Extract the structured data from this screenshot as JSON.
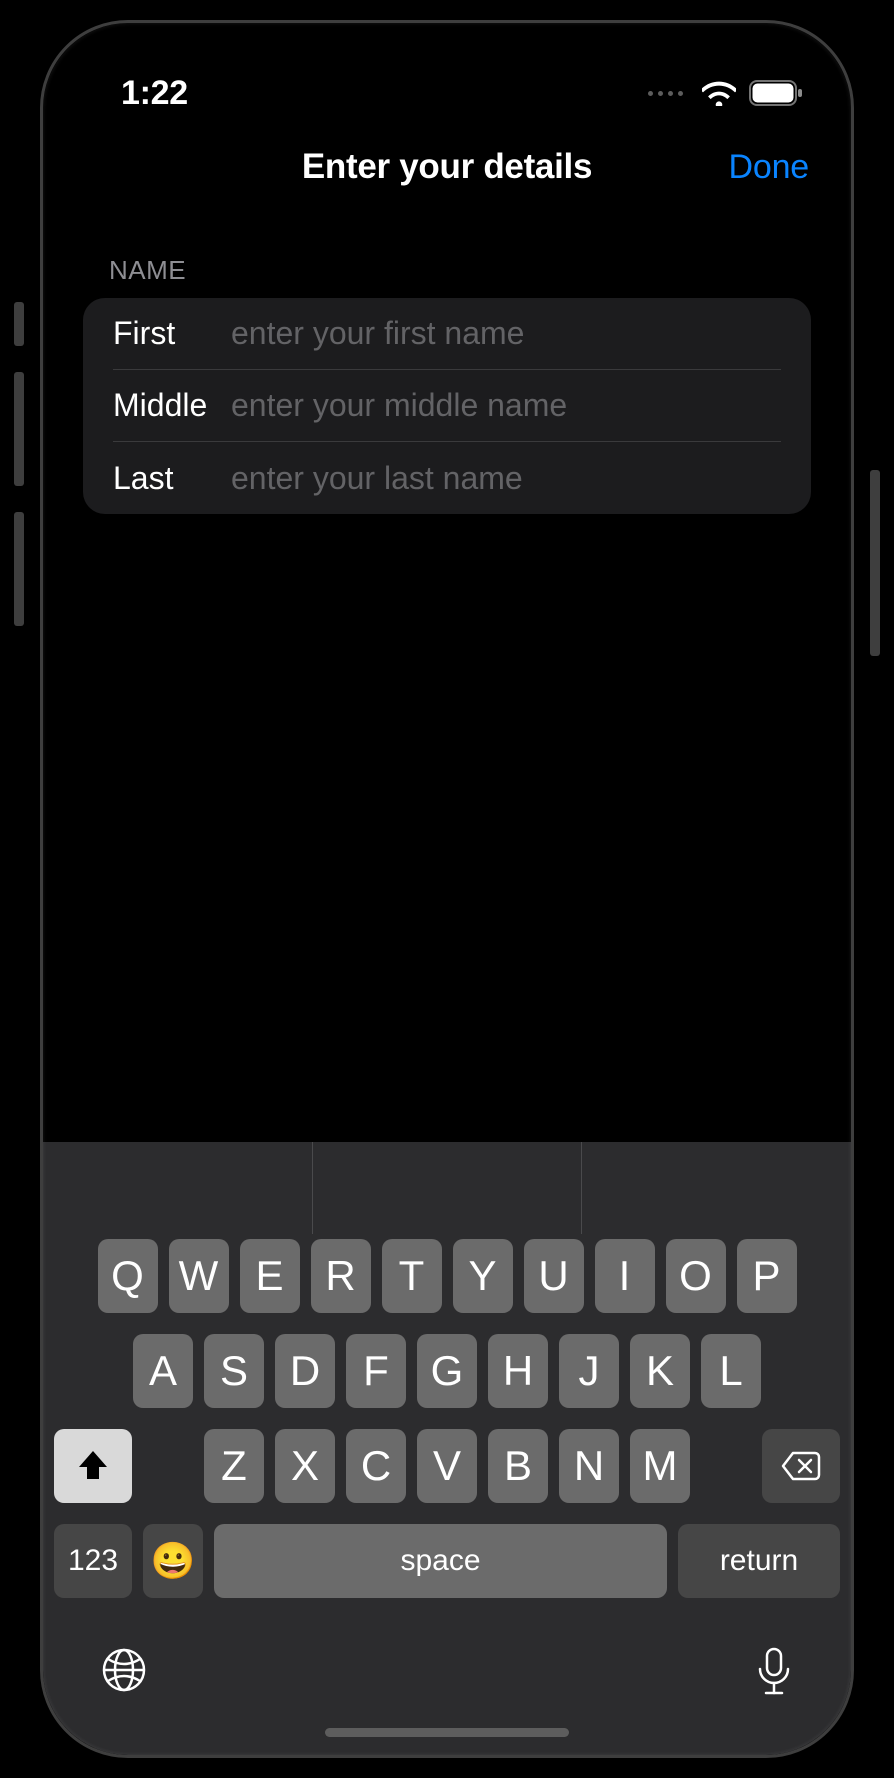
{
  "status": {
    "time": "1:22"
  },
  "nav": {
    "title": "Enter your details",
    "done": "Done"
  },
  "form": {
    "section_label": "NAME",
    "first": {
      "label": "First",
      "placeholder": "enter your first name",
      "value": ""
    },
    "middle": {
      "label": "Middle",
      "placeholder": "enter your middle name",
      "value": ""
    },
    "last": {
      "label": "Last",
      "placeholder": "enter your last name",
      "value": ""
    }
  },
  "keyboard": {
    "row1": [
      "Q",
      "W",
      "E",
      "R",
      "T",
      "Y",
      "U",
      "I",
      "O",
      "P"
    ],
    "row2": [
      "A",
      "S",
      "D",
      "F",
      "G",
      "H",
      "J",
      "K",
      "L"
    ],
    "row3": [
      "Z",
      "X",
      "C",
      "V",
      "B",
      "N",
      "M"
    ],
    "numbers_label": "123",
    "space_label": "space",
    "return_label": "return"
  }
}
